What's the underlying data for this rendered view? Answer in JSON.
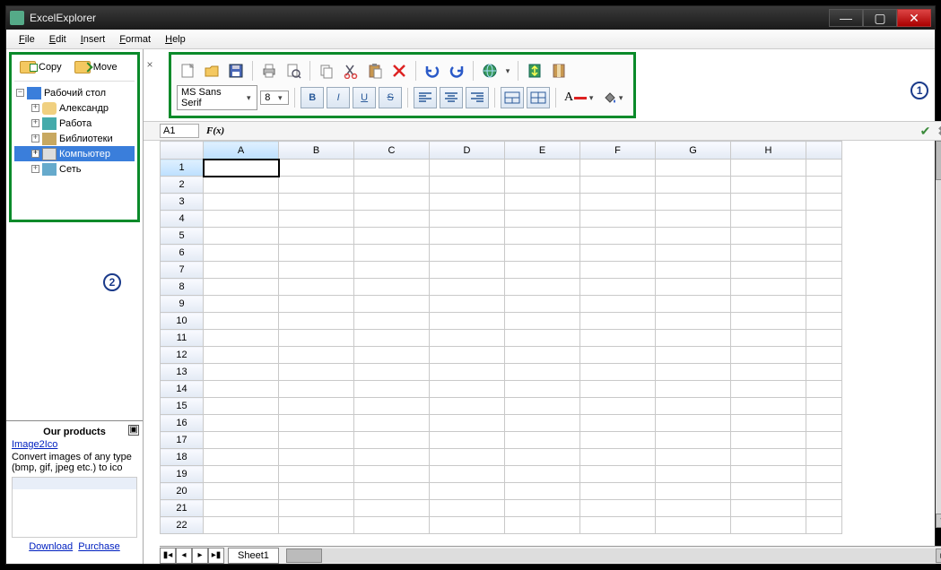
{
  "window": {
    "title": "ExcelExplorer"
  },
  "menu": {
    "file": "File",
    "edit": "Edit",
    "insert": "Insert",
    "format": "Format",
    "help": "Help"
  },
  "sidebar": {
    "copy": "Copy",
    "move": "Move",
    "tree": {
      "root": "Рабочий стол",
      "items": [
        "Александр",
        "Работа",
        "Библиотеки",
        "Компьютер",
        "Сеть"
      ],
      "selected_index": 3
    },
    "products": {
      "header": "Our products",
      "title": "Image2Ico",
      "desc": "Convert images of any type (bmp, gif, jpeg etc.) to ico",
      "download": "Download",
      "purchase": "Purchase"
    }
  },
  "toolbar": {
    "font": "MS Sans Serif",
    "size": "8"
  },
  "callouts": {
    "one": "1",
    "two": "2"
  },
  "formula": {
    "cell": "A1",
    "label": "F(x)"
  },
  "sheet": {
    "columns": [
      "A",
      "B",
      "C",
      "D",
      "E",
      "F",
      "G",
      "H"
    ],
    "rows": 22,
    "selected": {
      "col": 0,
      "row": 0
    },
    "tab": "Sheet1"
  }
}
